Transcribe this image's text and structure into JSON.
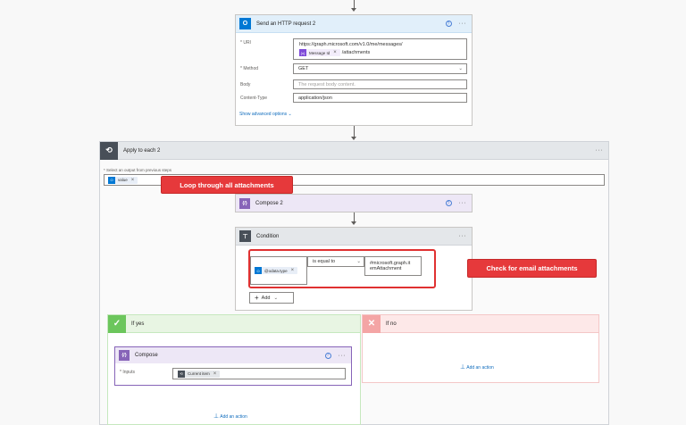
{
  "http_card": {
    "title": "Send an HTTP request 2",
    "uri_label": "* URI",
    "uri_value": "https://graph.microsoft.com/v1.0/me/messages/",
    "uri_token": "Message Id",
    "uri_suffix": "/attachments",
    "method_label": "* Method",
    "method_value": "GET",
    "body_label": "Body",
    "body_placeholder": "The request body content.",
    "content_type_label": "Content-Type",
    "content_type_value": "application/json",
    "show_advanced": "Show advanced options"
  },
  "apply_each": {
    "title": "Apply to each 2",
    "select_label": "* Select an output from previous steps",
    "value_token": "value"
  },
  "compose2": {
    "title": "Compose 2"
  },
  "condition": {
    "title": "Condition",
    "left_token": "@odata.type",
    "operator": "is equal to",
    "right_value_line1": "#microsoft.graph.it",
    "right_value_line2": "emAttachment",
    "add_label": "Add"
  },
  "if_yes": {
    "title": "If yes",
    "add_action": "Add an action"
  },
  "if_no": {
    "title": "If no",
    "add_action": "Add an action"
  },
  "compose": {
    "title": "Compose",
    "inputs_label": "* Inputs",
    "inputs_token": "Current item"
  },
  "callouts": {
    "loop": "Loop through all attachments",
    "email": "Check for email attachments"
  },
  "colors": {
    "http_accent": "#0078d4",
    "compose_accent": "#8764b8",
    "control_accent": "#484f58",
    "yes_accent": "#6cc65c",
    "no_accent": "#f4a5a5",
    "callout": "#e6393b"
  }
}
